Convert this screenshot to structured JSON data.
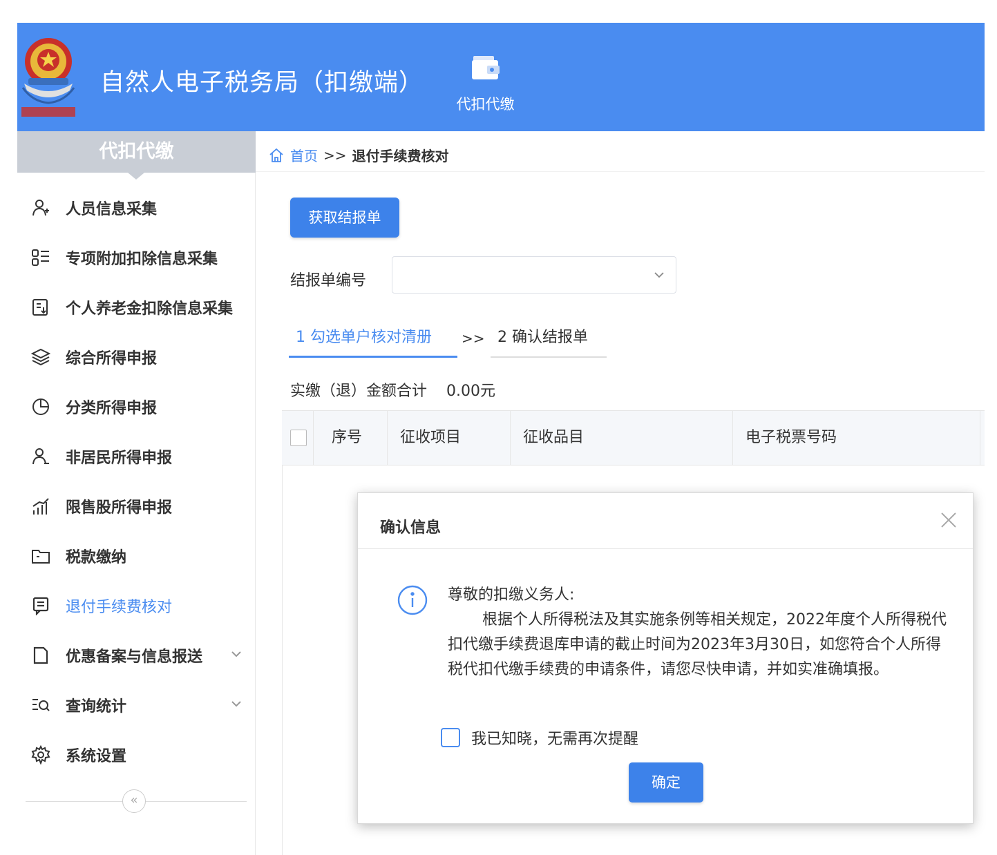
{
  "header": {
    "app_title": "自然人电子税务局（扣缴端）",
    "nav_tab_label": "代扣代缴",
    "nav_tab_icon": "wallet-icon",
    "brand_color": "#4a8cf0"
  },
  "sidebar": {
    "title": "代扣代缴",
    "items": [
      {
        "label": "人员信息采集",
        "icon": "person-icon"
      },
      {
        "label": "专项附加扣除信息采集",
        "icon": "list-icon"
      },
      {
        "label": "个人养老金扣除信息采集",
        "icon": "document-icon"
      },
      {
        "label": "综合所得申报",
        "icon": "layers-icon"
      },
      {
        "label": "分类所得申报",
        "icon": "pie-chart-icon"
      },
      {
        "label": "非居民所得申报",
        "icon": "user-icon"
      },
      {
        "label": "限售股所得申报",
        "icon": "bar-chart-icon"
      },
      {
        "label": "税款缴纳",
        "icon": "folder-icon"
      },
      {
        "label": "退付手续费核对",
        "icon": "form-icon",
        "active": true
      },
      {
        "label": "优惠备案与信息报送",
        "icon": "file-icon",
        "expandable": true
      },
      {
        "label": "查询统计",
        "icon": "search-list-icon",
        "expandable": true
      },
      {
        "label": "系统设置",
        "icon": "gear-icon"
      }
    ],
    "collapse_symbol": "«"
  },
  "breadcrumb": {
    "home": "首页",
    "separator": ">>",
    "current": "退付手续费核对"
  },
  "main": {
    "fetch_button": "获取结报单",
    "field_label": "结报单编号",
    "select_value": "",
    "steps": [
      {
        "label": "1 勾选单户核对清册",
        "active": true
      },
      {
        "label": "2 确认结报单",
        "active": false
      }
    ],
    "step_separator": ">>",
    "total_label": "实缴（退）金额合计",
    "total_value": "0.00元",
    "table_headers": [
      "序号",
      "征收项目",
      "征收品目",
      "电子税票号码"
    ]
  },
  "modal": {
    "title": "确认信息",
    "greeting": "尊敬的扣缴义务人:",
    "body": "根据个人所得税法及其实施条例等相关规定，2022年度个人所得税代扣代缴手续费退库申请的截止时间为2023年3月30日，如您符合个人所得税代扣代缴手续费的申请条件，请您尽快申请，并如实准确填报。",
    "ack_label": "我已知晓，无需再次提醒",
    "ok_button": "确定"
  }
}
